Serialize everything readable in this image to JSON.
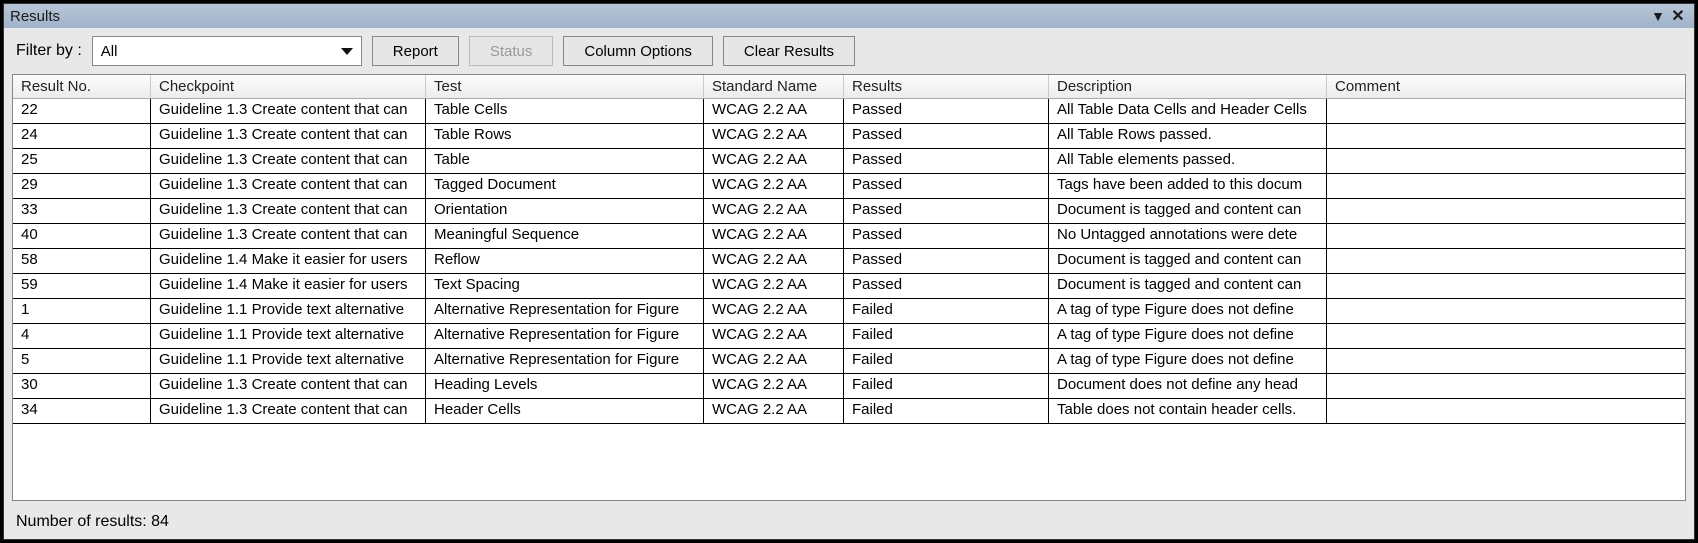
{
  "titlebar": {
    "title": "Results"
  },
  "toolbar": {
    "filter_label": "Filter by :",
    "filter_value": "All",
    "report_btn": "Report",
    "status_btn": "Status",
    "column_options_btn": "Column Options",
    "clear_results_btn": "Clear Results"
  },
  "columns": [
    "Result No.",
    "Checkpoint",
    "Test",
    "Standard Name",
    "Results",
    "Description",
    "Comment"
  ],
  "rows": [
    {
      "no": "22",
      "checkpoint": "Guideline 1.3 Create content that can",
      "test": "Table Cells",
      "standard": "WCAG 2.2 AA",
      "result": "Passed",
      "desc": "All Table Data Cells and Header Cells",
      "comment": ""
    },
    {
      "no": "24",
      "checkpoint": "Guideline 1.3 Create content that can",
      "test": "Table Rows",
      "standard": "WCAG 2.2 AA",
      "result": "Passed",
      "desc": "All Table Rows passed.",
      "comment": ""
    },
    {
      "no": "25",
      "checkpoint": "Guideline 1.3 Create content that can",
      "test": "Table",
      "standard": "WCAG 2.2 AA",
      "result": "Passed",
      "desc": "All Table elements passed.",
      "comment": ""
    },
    {
      "no": "29",
      "checkpoint": "Guideline 1.3 Create content that can",
      "test": "Tagged Document",
      "standard": "WCAG 2.2 AA",
      "result": "Passed",
      "desc": "Tags have been added to this docum",
      "comment": ""
    },
    {
      "no": "33",
      "checkpoint": "Guideline 1.3 Create content that can",
      "test": "Orientation",
      "standard": "WCAG 2.2 AA",
      "result": "Passed",
      "desc": "Document is tagged and content can",
      "comment": ""
    },
    {
      "no": "40",
      "checkpoint": "Guideline 1.3 Create content that can",
      "test": "Meaningful Sequence",
      "standard": "WCAG 2.2 AA",
      "result": "Passed",
      "desc": "No Untagged annotations were dete",
      "comment": ""
    },
    {
      "no": "58",
      "checkpoint": "Guideline 1.4 Make it easier for users",
      "test": "Reflow",
      "standard": "WCAG 2.2 AA",
      "result": "Passed",
      "desc": "Document is tagged and content can",
      "comment": ""
    },
    {
      "no": "59",
      "checkpoint": "Guideline 1.4 Make it easier for users",
      "test": "Text Spacing",
      "standard": "WCAG 2.2 AA",
      "result": "Passed",
      "desc": "Document is tagged and content can",
      "comment": ""
    },
    {
      "no": "1",
      "checkpoint": "Guideline 1.1 Provide text alternative",
      "test": "Alternative Representation for Figure",
      "standard": "WCAG 2.2 AA",
      "result": "Failed",
      "desc": "A tag of type Figure does not define",
      "comment": ""
    },
    {
      "no": "4",
      "checkpoint": "Guideline 1.1 Provide text alternative",
      "test": "Alternative Representation for Figure",
      "standard": "WCAG 2.2 AA",
      "result": "Failed",
      "desc": "A tag of type Figure does not define",
      "comment": ""
    },
    {
      "no": "5",
      "checkpoint": "Guideline 1.1 Provide text alternative",
      "test": "Alternative Representation for Figure",
      "standard": "WCAG 2.2 AA",
      "result": "Failed",
      "desc": "A tag of type Figure does not define",
      "comment": ""
    },
    {
      "no": "30",
      "checkpoint": "Guideline 1.3 Create content that can",
      "test": "Heading Levels",
      "standard": "WCAG 2.2 AA",
      "result": "Failed",
      "desc": "Document does not define any head",
      "comment": ""
    },
    {
      "no": "34",
      "checkpoint": "Guideline 1.3 Create content that can",
      "test": "Header Cells",
      "standard": "WCAG 2.2 AA",
      "result": "Failed",
      "desc": "Table does not contain header cells.",
      "comment": ""
    }
  ],
  "statusbar": {
    "count_label": "Number of results: 84"
  }
}
